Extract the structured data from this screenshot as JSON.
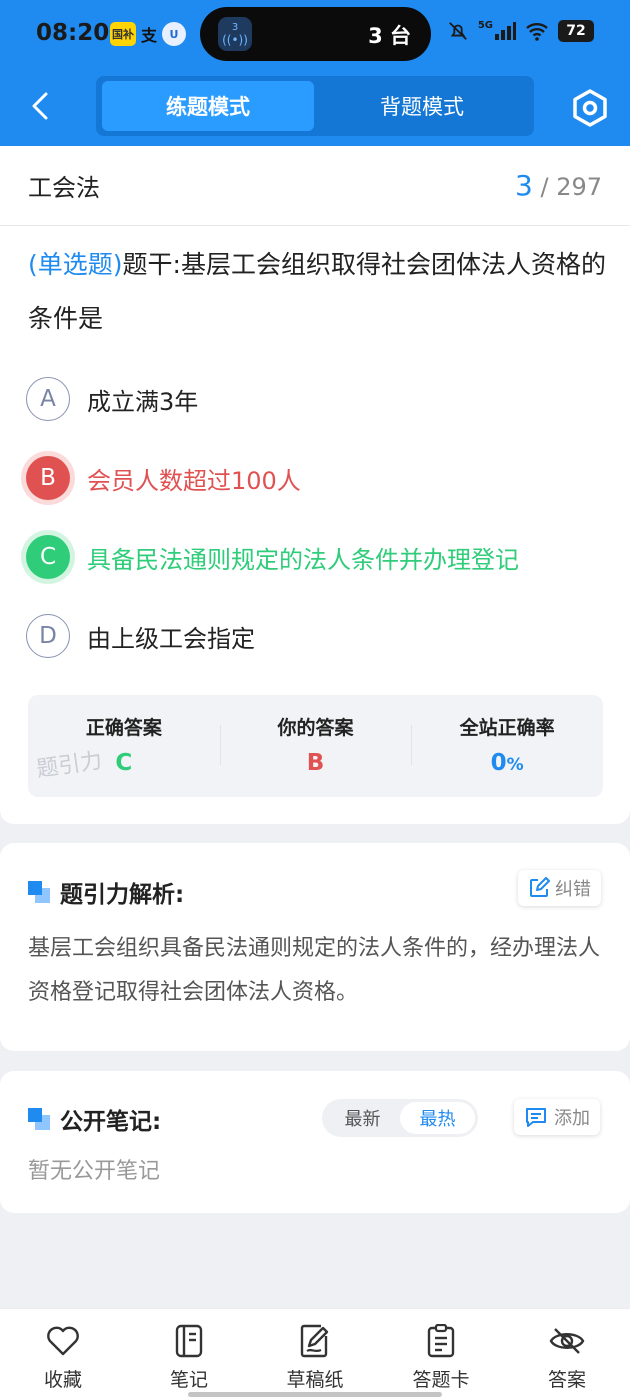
{
  "status_bar": {
    "time": "08:20",
    "app_badges": [
      "国补",
      "支",
      "U"
    ],
    "island_badge": "3",
    "island_text": "3 台",
    "network": "5G",
    "battery": "72"
  },
  "header": {
    "tabs": [
      {
        "label": "练题模式",
        "active": true
      },
      {
        "label": "背题模式",
        "active": false
      }
    ]
  },
  "subject": {
    "title": "工会法",
    "current": "3",
    "separator": "/",
    "total": "297"
  },
  "question": {
    "type": "(单选题)",
    "text": "题干:基层工会组织取得社会团体法人资格的条件是",
    "options": [
      {
        "letter": "A",
        "text": "成立满3年",
        "state": "normal"
      },
      {
        "letter": "B",
        "text": "会员人数超过100人",
        "state": "wrong"
      },
      {
        "letter": "C",
        "text": "具备民法通则规定的法人条件并办理登记",
        "state": "correct"
      },
      {
        "letter": "D",
        "text": "由上级工会指定",
        "state": "normal"
      }
    ]
  },
  "answer_summary": {
    "correct_label": "正确答案",
    "correct_value": "C",
    "yours_label": "你的答案",
    "yours_value": "B",
    "rate_label": "全站正确率",
    "rate_value": "0",
    "rate_unit": "%",
    "watermark": "题引力"
  },
  "analysis": {
    "title": "题引力解析:",
    "report_label": "纠错",
    "text": "基层工会组织具备民法通则规定的法人条件的，经办理法人资格登记取得社会团体法人资格。"
  },
  "notes": {
    "title": "公开笔记:",
    "sort_options": [
      {
        "label": "最新",
        "active": false
      },
      {
        "label": "最热",
        "active": true
      }
    ],
    "add_label": "添加",
    "empty_text": "暂无公开笔记"
  },
  "bottom_bar": [
    {
      "label": "收藏",
      "icon": "heart-icon"
    },
    {
      "label": "笔记",
      "icon": "notebook-icon"
    },
    {
      "label": "草稿纸",
      "icon": "draft-icon"
    },
    {
      "label": "答题卡",
      "icon": "answer-sheet-icon"
    },
    {
      "label": "答案",
      "icon": "eye-off-icon"
    }
  ],
  "colors": {
    "brand": "#1f8bf0",
    "correct": "#2fcc79",
    "wrong": "#e05252"
  }
}
